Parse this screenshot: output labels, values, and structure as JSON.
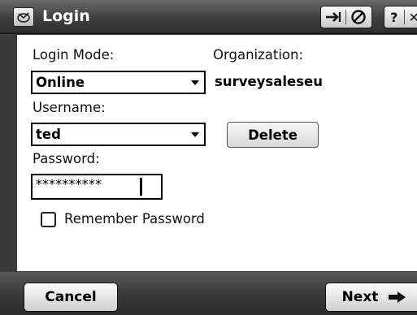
{
  "titlebar": {
    "title": "Login",
    "ok_glyph": "→|✓",
    "help_glyph": "?",
    "close_glyph": "✕"
  },
  "form": {
    "login_mode_label": "Login Mode:",
    "login_mode_value": "Online",
    "organization_label": "Organization:",
    "organization_value": "surveysaleseu",
    "username_label": "Username:",
    "username_value": "ted",
    "delete_label": "Delete",
    "password_label": "Password:",
    "password_value": "**********",
    "remember_label": "Remember Password",
    "remember_checked": false
  },
  "bottombar": {
    "cancel_label": "Cancel",
    "next_label": "Next"
  },
  "icons": [
    "app-icon",
    "enter-icon",
    "check-icon",
    "help-icon",
    "close-icon",
    "dropdown-arrow-icon",
    "arrow-right-icon"
  ]
}
